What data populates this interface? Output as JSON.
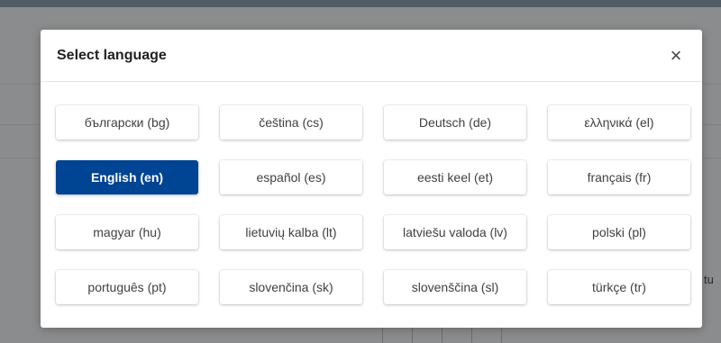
{
  "modal": {
    "title": "Select language",
    "close_label": "×",
    "accent_color": "#004494"
  },
  "languages": [
    {
      "label": "български (bg)",
      "code": "bg",
      "selected": false
    },
    {
      "label": "čeština (cs)",
      "code": "cs",
      "selected": false
    },
    {
      "label": "Deutsch (de)",
      "code": "de",
      "selected": false
    },
    {
      "label": "ελληνικά (el)",
      "code": "el",
      "selected": false
    },
    {
      "label": "English (en)",
      "code": "en",
      "selected": true
    },
    {
      "label": "español (es)",
      "code": "es",
      "selected": false
    },
    {
      "label": "eesti keel (et)",
      "code": "et",
      "selected": false
    },
    {
      "label": "français (fr)",
      "code": "fr",
      "selected": false
    },
    {
      "label": "magyar (hu)",
      "code": "hu",
      "selected": false
    },
    {
      "label": "lietuvių kalba (lt)",
      "code": "lt",
      "selected": false
    },
    {
      "label": "latviešu valoda (lv)",
      "code": "lv",
      "selected": false
    },
    {
      "label": "polski (pl)",
      "code": "pl",
      "selected": false
    },
    {
      "label": "português (pt)",
      "code": "pt",
      "selected": false
    },
    {
      "label": "slovenčina (sk)",
      "code": "sk",
      "selected": false
    },
    {
      "label": "slovenščina (sl)",
      "code": "sl",
      "selected": false
    },
    {
      "label": "türkçe (tr)",
      "code": "tr",
      "selected": false
    }
  ],
  "background": {
    "partial_text": "tu"
  }
}
